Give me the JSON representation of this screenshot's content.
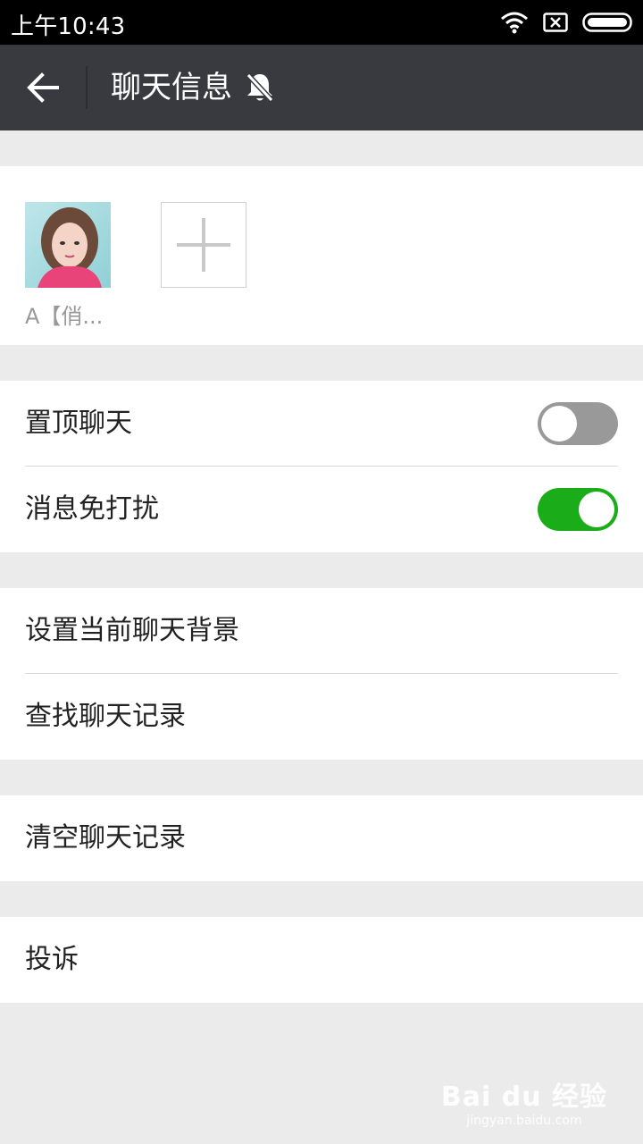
{
  "status_bar": {
    "time": "上午10:43",
    "icons": [
      "wifi-icon",
      "sim-off-icon",
      "battery-icon"
    ]
  },
  "app_bar": {
    "title": "聊天信息",
    "back_icon": "arrow-left-icon",
    "mute_icon": "bell-off-icon"
  },
  "members": [
    {
      "name": "A【俏..."
    }
  ],
  "add_member_icon": "plus-icon",
  "settings": {
    "pin_chat": {
      "label": "置顶聊天",
      "enabled": false
    },
    "mute_notifications": {
      "label": "消息免打扰",
      "enabled": true
    },
    "set_background": {
      "label": "设置当前聊天背景"
    },
    "search_history": {
      "label": "查找聊天记录"
    },
    "clear_history": {
      "label": "清空聊天记录"
    },
    "report": {
      "label": "投诉"
    }
  },
  "watermark": {
    "main": "Bai du 经验",
    "sub": "jingyan.baidu.com"
  },
  "colors": {
    "app_bar": "#393a3f",
    "background": "#ebebeb",
    "toggle_on": "#1aad19",
    "toggle_off": "#999999"
  }
}
